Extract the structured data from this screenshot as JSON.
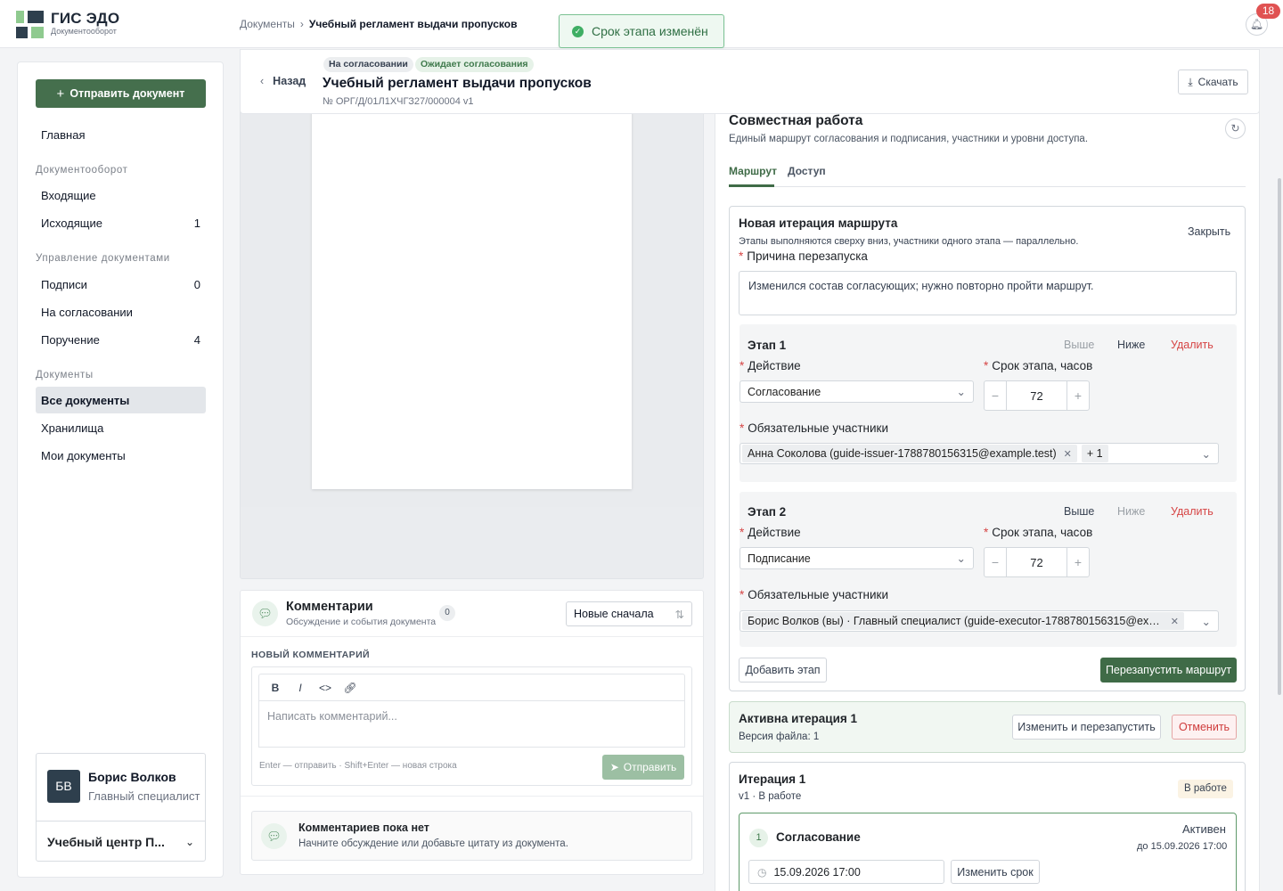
{
  "brand": {
    "title": "ГИС ЭДО",
    "subtitle": "Документооборот"
  },
  "breadcrumb": {
    "root": "Документы",
    "sep": "›",
    "current": "Учебный регламент выдачи пропусков"
  },
  "toast": {
    "text": "Срок этапа изменён"
  },
  "notifications": {
    "count": "18"
  },
  "sidebar": {
    "send_label": "Отправить документ",
    "home": "Главная",
    "sections": [
      "Документооборот",
      "Управление документами",
      "Документы"
    ],
    "items": [
      {
        "label": "Входящие",
        "count": ""
      },
      {
        "label": "Исходящие",
        "count": "1"
      },
      {
        "label": "Подписи",
        "count": "0"
      },
      {
        "label": "На согласовании",
        "count": ""
      },
      {
        "label": "Поручение",
        "count": "4"
      },
      {
        "label": "Все документы",
        "count": ""
      },
      {
        "label": "Хранилища",
        "count": ""
      },
      {
        "label": "Мои документы",
        "count": ""
      }
    ],
    "user": {
      "initials": "БВ",
      "name": "Борис Волков",
      "role": "Главный специалист"
    },
    "org": "Учебный центр П..."
  },
  "doc": {
    "back": "Назад",
    "tag1": "На согласовании",
    "tag2": "Ожидает согласования",
    "title": "Учебный регламент выдачи пропусков",
    "number": "№ ОРГ/Д/01Л1ХЧГЗ27/000004  v1",
    "download": "Скачать"
  },
  "comments": {
    "title": "Комментарии",
    "subtitle": "Обсуждение и события документа",
    "count": "0",
    "sort": "Новые сначала",
    "new_label": "НОВЫЙ КОММЕНТАРИЙ",
    "placeholder": "Написать комментарий...",
    "hint": "Enter — отправить · Shift+Enter — новая строка",
    "send": "Отправить",
    "empty_title": "Комментариев пока нет",
    "empty_sub": "Начните обсуждение или добавьте цитату из документа."
  },
  "collab": {
    "title": "Совместная работа",
    "subtitle": "Единый маршрут согласования и подписания, участники и уровни доступа.",
    "tabs": [
      "Маршрут",
      "Доступ"
    ],
    "new_iter": {
      "title": "Новая итерация маршрута",
      "subtitle": "Этапы выполняются сверху вниз, участники одного этапа — параллельно.",
      "close": "Закрыть",
      "reason_label": "Причина перезапуска",
      "reason": "Изменился состав согласующих; нужно повторно пройти маршрут.",
      "action_label": "Действие",
      "deadline_label": "Срок этапа, часов",
      "participants_label": "Обязательные участники",
      "up": "Выше",
      "down": "Ниже",
      "delete": "Удалить",
      "stages": [
        {
          "name": "Этап 1",
          "action": "Согласование",
          "hours": "72",
          "participant": "Анна Соколова (guide-issuer-1788780156315@example.test)",
          "more": "+ 1"
        },
        {
          "name": "Этап 2",
          "action": "Подписание",
          "hours": "72",
          "participant": "Борис Волков (вы) · Главный специалист (guide-executor-1788780156315@exa...",
          "more": ""
        }
      ],
      "add_stage": "Добавить этап",
      "restart": "Перезапустить маршрут"
    },
    "active": {
      "title": "Активна итерация 1",
      "file": "Версия файла: 1",
      "change": "Изменить и перезапустить",
      "cancel": "Отменить"
    },
    "iteration": {
      "title": "Итерация 1",
      "sub": "v1 · В работе",
      "status": "В работе",
      "stage_no": "1",
      "stage_name": "Согласование",
      "stage_state": "Активен",
      "due": "до 15.09.2026 17:00",
      "date": "15.09.2026 17:00",
      "change": "Изменить срок"
    }
  },
  "colors": {
    "accent": "#456f4d",
    "danger": "#d64545",
    "toast_bg": "#eef8f1"
  }
}
